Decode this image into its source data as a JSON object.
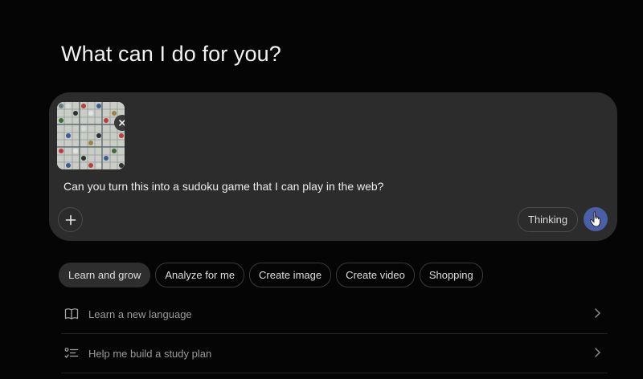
{
  "heading": "What can I do for you?",
  "composer": {
    "attachment_icon": "sudoku-board-thumbnail",
    "remove_attachment_icon": "close-icon",
    "prompt": "Can you turn this into a sudoku game that I can play in the web?",
    "add_icon": "plus-icon",
    "mode_label": "Thinking",
    "send_icon": "send-icon",
    "send_color": "#4a5fa8"
  },
  "chips": [
    {
      "label": "Learn and grow",
      "active": true
    },
    {
      "label": "Analyze for me",
      "active": false
    },
    {
      "label": "Create image",
      "active": false
    },
    {
      "label": "Create video",
      "active": false
    },
    {
      "label": "Shopping",
      "active": false
    }
  ],
  "suggestions": [
    {
      "icon": "book-icon",
      "label": "Learn a new language"
    },
    {
      "icon": "checklist-icon",
      "label": "Help me build a study plan"
    }
  ]
}
